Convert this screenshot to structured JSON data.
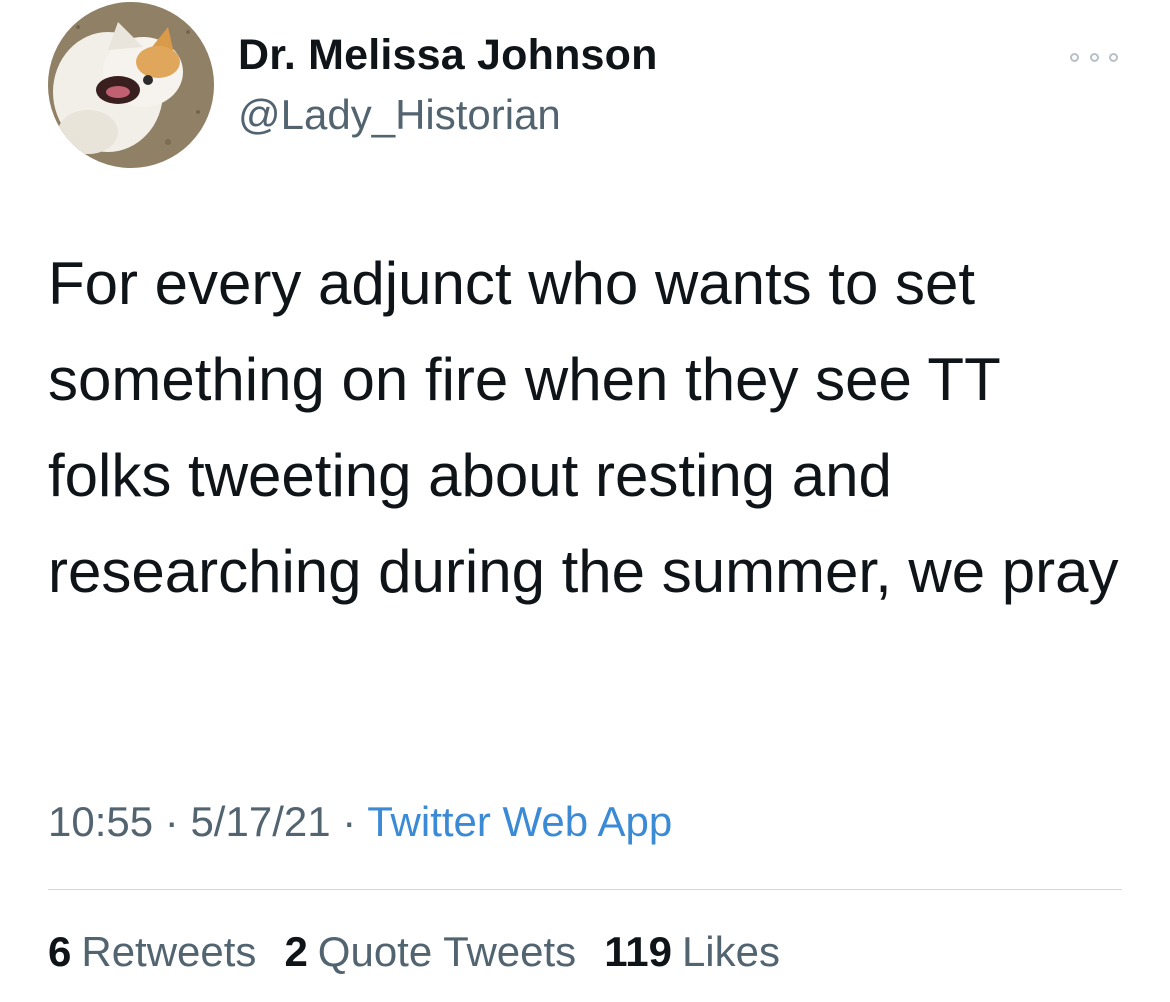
{
  "user": {
    "display_name": "Dr. Melissa Johnson",
    "handle": "@Lady_Historian",
    "avatar_icon": "cat-avatar"
  },
  "menu": {
    "icon": "more-options-icon"
  },
  "tweet": {
    "text": "For every adjunct who wants to set something on fire when they see TT folks tweeting about resting and researching during the summer, we pray"
  },
  "meta": {
    "time": "10:55",
    "separator": "·",
    "date": "5/17/21",
    "source": "Twitter Web App"
  },
  "stats": {
    "retweets_count": "6",
    "retweets_label": "Retweets",
    "quotes_count": "2",
    "quotes_label": "Quote Tweets",
    "likes_count": "119",
    "likes_label": "Likes"
  },
  "colors": {
    "text": "#0f1419",
    "secondary": "#536471",
    "link": "#3b8ad6",
    "divider": "#cfd9de"
  }
}
